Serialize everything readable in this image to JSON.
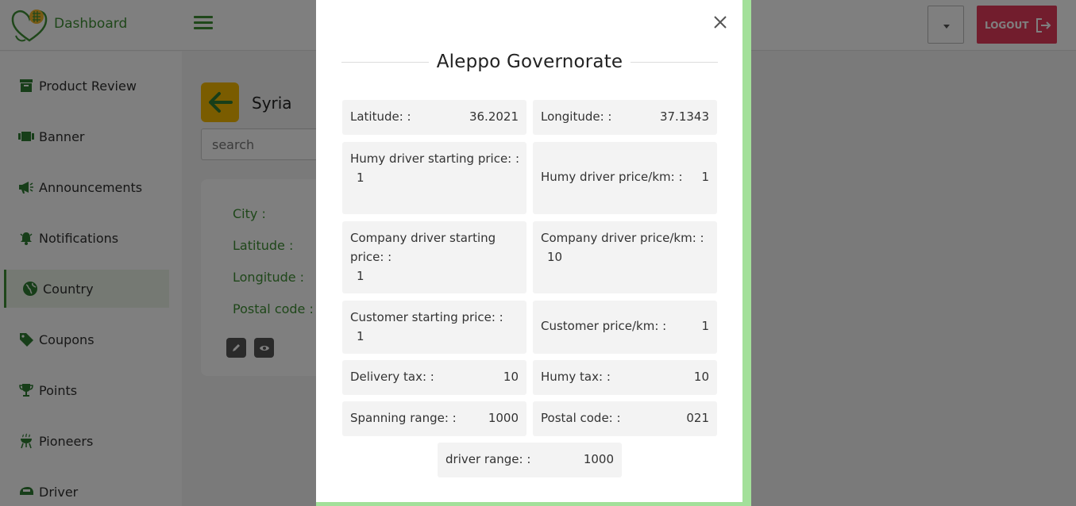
{
  "header": {
    "brand": "Dashboard",
    "logout_label": "LOGOUT"
  },
  "sidebar": {
    "items": [
      {
        "label": "Product Review",
        "icon": "archive-icon"
      },
      {
        "label": "Banner",
        "icon": "banner-icon"
      },
      {
        "label": "Announcements",
        "icon": "megaphone-icon"
      },
      {
        "label": "Notifications",
        "icon": "bell-icon"
      },
      {
        "label": "Country",
        "icon": "globe-icon",
        "active": true
      },
      {
        "label": "Coupons",
        "icon": "tag-icon"
      },
      {
        "label": "Points",
        "icon": "trophy-icon"
      },
      {
        "label": "Pioneers",
        "icon": "grill-icon"
      },
      {
        "label": "Driver",
        "icon": "driver-icon"
      }
    ]
  },
  "main": {
    "country": "Syria",
    "search_placeholder": "search",
    "card_labels": [
      "City :",
      "Latitude :",
      "Longitude :",
      "Postal code :"
    ]
  },
  "modal": {
    "title": "Aleppo Governorate",
    "fields": {
      "latitude": {
        "label": "Latitude: :",
        "value": "36.2021"
      },
      "longitude": {
        "label": "Longitude: :",
        "value": "37.1343"
      },
      "humy_start": {
        "label": "Humy driver starting price: :",
        "value": "1"
      },
      "humy_km": {
        "label": "Humy driver price/km: :",
        "value": "1"
      },
      "company_start": {
        "label": "Company driver starting price: :",
        "value": "1"
      },
      "company_km": {
        "label": "Company driver price/km: :",
        "value": "10"
      },
      "customer_start": {
        "label": "Customer starting price: :",
        "value": "1"
      },
      "customer_km": {
        "label": "Customer price/km: :",
        "value": "1"
      },
      "delivery_tax": {
        "label": "Delivery tax: :",
        "value": "10"
      },
      "humy_tax": {
        "label": "Humy tax: :",
        "value": "10"
      },
      "spanning_range": {
        "label": "Spanning range: :",
        "value": "1000"
      },
      "postal_code": {
        "label": "Postal code: :",
        "value": "021"
      },
      "driver_range": {
        "label": "driver range: :",
        "value": "1000"
      }
    }
  },
  "colors": {
    "brand_green": "#3f8f34",
    "logout_red": "#e53b5b",
    "back_yellow": "#f5b800",
    "modal_accent": "#a3e09a"
  }
}
